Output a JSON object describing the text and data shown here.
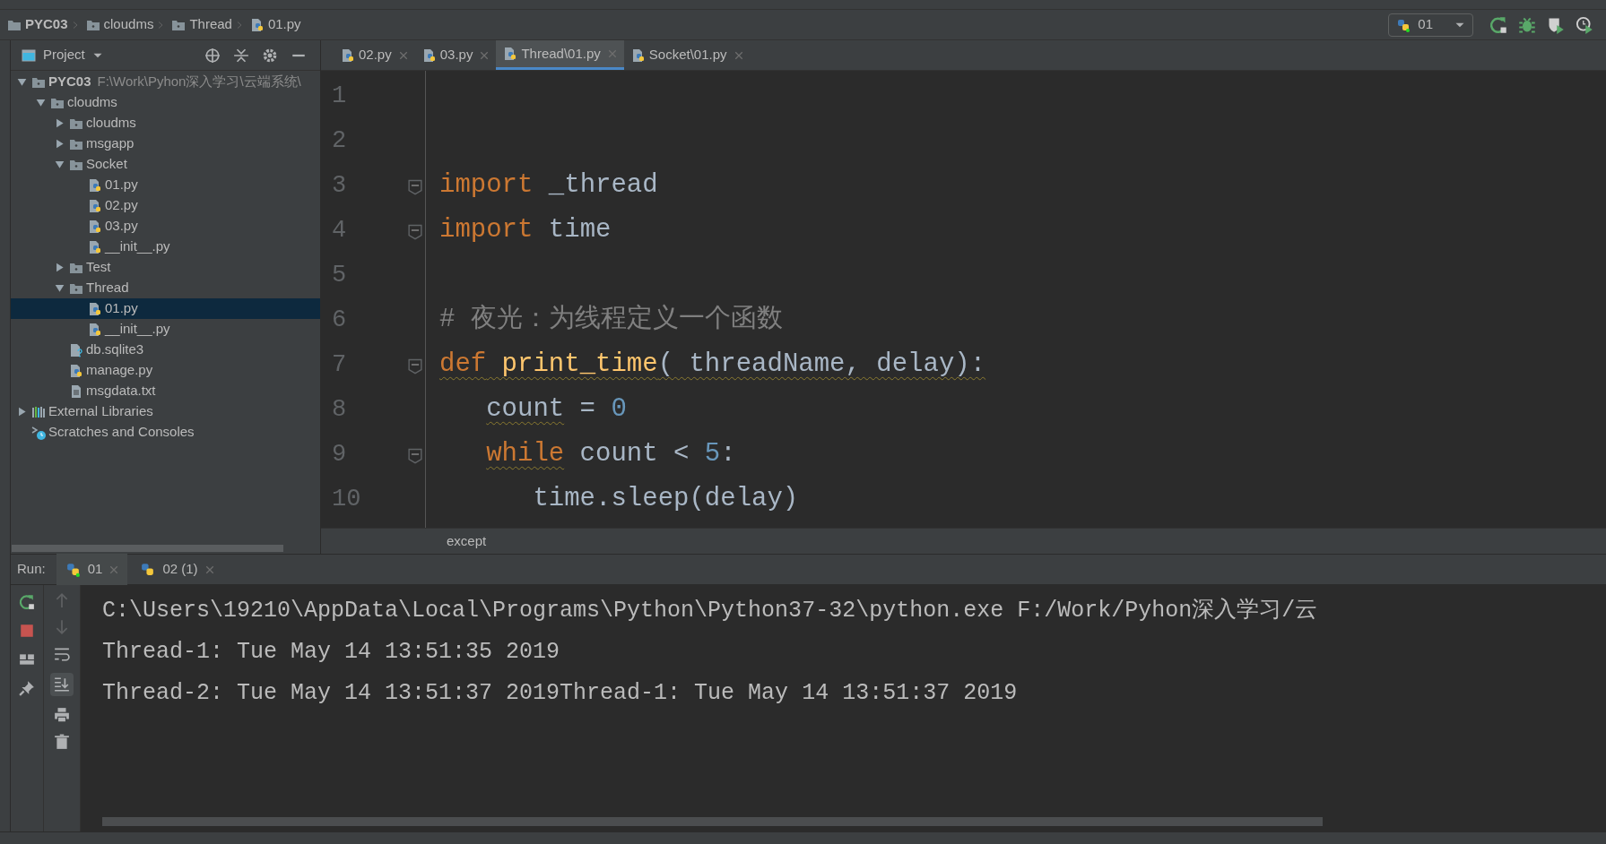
{
  "breadcrumbs": [
    {
      "label": "PYC03",
      "kind": "project"
    },
    {
      "label": "cloudms",
      "kind": "folder"
    },
    {
      "label": "Thread",
      "kind": "folder"
    },
    {
      "label": "01.py",
      "kind": "py"
    }
  ],
  "run_config": {
    "label": "01"
  },
  "project_panel": {
    "title": "Project",
    "tree": [
      {
        "label": "PYC03",
        "kind": "folder",
        "path": "F:\\Work\\Pyhon深入学习\\云端系统\\",
        "expanded": true,
        "selected": false,
        "children": [
          {
            "label": "cloudms",
            "kind": "folder",
            "expanded": true,
            "selected": false,
            "children": [
              {
                "label": "cloudms",
                "kind": "folder",
                "expanded": false,
                "selected": false
              },
              {
                "label": "msgapp",
                "kind": "folder",
                "expanded": false,
                "selected": false
              },
              {
                "label": "Socket",
                "kind": "folder",
                "expanded": true,
                "selected": false,
                "children": [
                  {
                    "label": "01.py",
                    "kind": "py",
                    "selected": false
                  },
                  {
                    "label": "02.py",
                    "kind": "py",
                    "selected": false
                  },
                  {
                    "label": "03.py",
                    "kind": "py",
                    "selected": false
                  },
                  {
                    "label": "__init__.py",
                    "kind": "py",
                    "selected": false
                  }
                ]
              },
              {
                "label": "Test",
                "kind": "folder",
                "expanded": false,
                "selected": false
              },
              {
                "label": "Thread",
                "kind": "folder",
                "expanded": true,
                "selected": false,
                "children": [
                  {
                    "label": "01.py",
                    "kind": "py",
                    "selected": true
                  },
                  {
                    "label": "__init__.py",
                    "kind": "py",
                    "selected": false
                  }
                ]
              },
              {
                "label": "db.sqlite3",
                "kind": "db",
                "selected": false
              },
              {
                "label": "manage.py",
                "kind": "py",
                "selected": false
              },
              {
                "label": "msgdata.txt",
                "kind": "txt",
                "selected": false
              }
            ]
          }
        ]
      },
      {
        "label": "External Libraries",
        "kind": "libraries",
        "expanded": false,
        "selected": false
      },
      {
        "label": "Scratches and Consoles",
        "kind": "scratches",
        "selected": false
      }
    ]
  },
  "editor": {
    "tabs": [
      {
        "label": "02.py",
        "selected": false
      },
      {
        "label": "03.py",
        "selected": false
      },
      {
        "label": "Thread\\01.py",
        "selected": true
      },
      {
        "label": "Socket\\01.py",
        "selected": false
      }
    ],
    "lines": [
      {
        "number": "1",
        "fold": false
      },
      {
        "number": "2",
        "fold": false
      },
      {
        "number": "3",
        "fold": true,
        "tokens": [
          {
            "kind": "keyword",
            "text": "import",
            "warning": false
          },
          {
            "kind": "plain",
            "text": " _thread",
            "warning": false
          }
        ]
      },
      {
        "number": "4",
        "fold": true,
        "tokens": [
          {
            "kind": "keyword",
            "text": "import",
            "warning": false
          },
          {
            "kind": "plain",
            "text": " time",
            "warning": false
          }
        ]
      },
      {
        "number": "5",
        "fold": false
      },
      {
        "number": "6",
        "fold": false,
        "tokens": [
          {
            "kind": "comment",
            "text": "# 夜光：为线程定义一个函数",
            "warning": false
          }
        ]
      },
      {
        "number": "7",
        "fold": true,
        "tokens": [
          {
            "kind": "keyword",
            "text": "def",
            "warning": true
          },
          {
            "kind": "function",
            "text": " print_time",
            "warning": true
          },
          {
            "kind": "plain",
            "text": "( threadName, delay):",
            "warning": true
          }
        ],
        "children": [
          {
            "number": "8",
            "fold": false,
            "tokens": [
              {
                "kind": "plain",
                "text": "count",
                "warning": true
              },
              {
                "kind": "plain",
                "text": " = ",
                "warning": false
              },
              {
                "kind": "number",
                "text": "0",
                "warning": false
              }
            ]
          },
          {
            "number": "9",
            "fold": true,
            "tokens": [
              {
                "kind": "keyword",
                "text": "while",
                "warning": true
              },
              {
                "kind": "plain",
                "text": " count < ",
                "warning": false
              },
              {
                "kind": "number",
                "text": "5",
                "warning": false
              },
              {
                "kind": "plain",
                "text": ":",
                "warning": false
              }
            ],
            "children": [
              {
                "number": "10",
                "fold": false,
                "tokens": [
                  {
                    "kind": "plain",
                    "text": "time.sleep(delay)",
                    "warning": false
                  }
                ]
              }
            ]
          }
        ]
      }
    ],
    "breadcrumb": "except"
  },
  "run_panel": {
    "label": "Run:",
    "tabs": [
      {
        "label": "01",
        "selected": true,
        "running": true
      },
      {
        "label": "02 (1)",
        "selected": false,
        "running": false
      }
    ],
    "output": [
      "C:\\Users\\19210\\AppData\\Local\\Programs\\Python\\Python37-32\\python.exe F:/Work/Pyhon深入学习/云",
      "Thread-1: Tue May 14 13:51:35 2019",
      "Thread-2: Tue May 14 13:51:37 2019Thread-1: Tue May 14 13:51:37 2019"
    ]
  }
}
